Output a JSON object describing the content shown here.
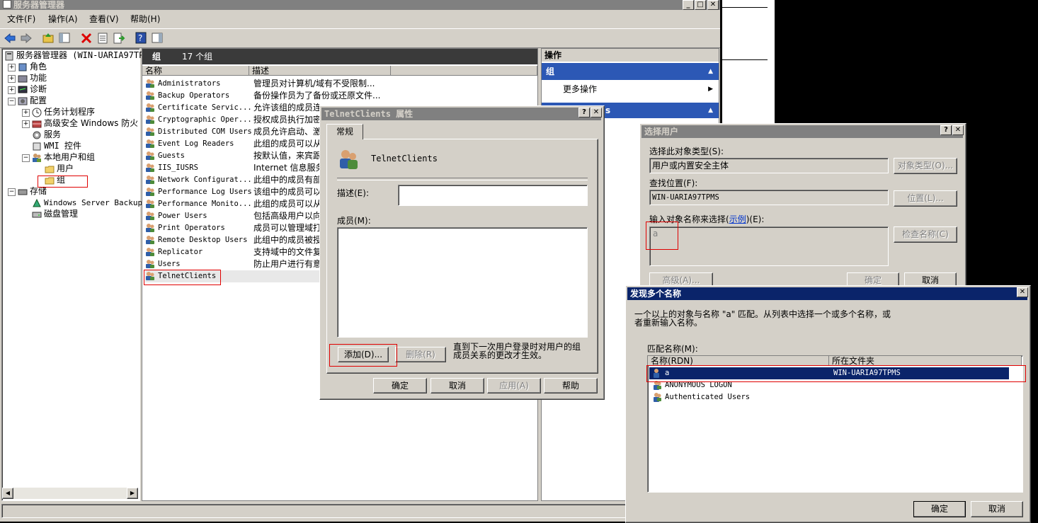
{
  "main_window": {
    "title": "服务器管理器",
    "menu": [
      "文件(F)",
      "操作(A)",
      "查看(V)",
      "帮助(H)"
    ],
    "caption_buttons": [
      "_",
      "□",
      "✕"
    ]
  },
  "tree": {
    "root": "服务器管理器 (WIN-UARIA97TPM",
    "items": [
      {
        "label": "角色"
      },
      {
        "label": "功能"
      },
      {
        "label": "诊断"
      },
      {
        "label": "配置"
      },
      {
        "label": "任务计划程序"
      },
      {
        "label": "高级安全 Windows 防火墙"
      },
      {
        "label": "服务"
      },
      {
        "label": "WMI 控件"
      },
      {
        "label": "本地用户和组"
      },
      {
        "label": "用户"
      },
      {
        "label": "组"
      },
      {
        "label": "存储"
      },
      {
        "label": "Windows Server Backup"
      },
      {
        "label": "磁盘管理"
      }
    ]
  },
  "groups_panel": {
    "header": "组",
    "count": "17 个组",
    "columns": [
      "名称",
      "描述"
    ],
    "rows": [
      {
        "name": "Administrators",
        "desc": "管理员对计算机/域有不受限制..."
      },
      {
        "name": "Backup Operators",
        "desc": "备份操作员为了备份或还原文件..."
      },
      {
        "name": "Certificate Servic...",
        "desc": "允许该组的成员连"
      },
      {
        "name": "Cryptographic Oper...",
        "desc": "授权成员执行加密"
      },
      {
        "name": "Distributed COM Users",
        "desc": "成员允许启动、激"
      },
      {
        "name": "Event Log Readers",
        "desc": "此组的成员可以从"
      },
      {
        "name": "Guests",
        "desc": "按默认值，来宾跟"
      },
      {
        "name": "IIS_IUSRS",
        "desc": "Internet 信息服务"
      },
      {
        "name": "Network Configurat...",
        "desc": "此组中的成员有部"
      },
      {
        "name": "Performance Log Users",
        "desc": "该组中的成员可以"
      },
      {
        "name": "Performance Monito...",
        "desc": "此组的成员可以从"
      },
      {
        "name": "Power Users",
        "desc": "包括高级用户以向"
      },
      {
        "name": "Print Operators",
        "desc": "成员可以管理域打"
      },
      {
        "name": "Remote Desktop Users",
        "desc": "此组中的成员被授"
      },
      {
        "name": "Replicator",
        "desc": "支持域中的文件复"
      },
      {
        "name": "Users",
        "desc": "防止用户进行有意"
      },
      {
        "name": "TelnetClients",
        "desc": ""
      }
    ]
  },
  "actions_panel": {
    "header": "操作",
    "section1": "组",
    "more": "更多操作",
    "section2": "s"
  },
  "props_dialog": {
    "title": "TelnetClients 属性",
    "tab": "常规",
    "group_name": "TelnetClients",
    "desc_label": "描述(E):",
    "members_label": "成员(M):",
    "add_btn": "添加(D)...",
    "remove_btn": "删除(R)",
    "note": "直到下一次用户登录时对用户的组成员关系的更改才生效。",
    "ok": "确定",
    "cancel": "取消",
    "apply": "应用(A)",
    "help": "帮助"
  },
  "select_users": {
    "title": "选择用户",
    "obj_type_label": "选择此对象类型(S):",
    "obj_type_value": "用户或内置安全主体",
    "obj_type_btn": "对象类型(O)...",
    "location_label": "查找位置(F):",
    "location_value": "WIN-UARIA97TPMS",
    "location_btn": "位置(L)...",
    "enter_label_pre": "输入对象名称来选择(",
    "enter_label_link": "示例",
    "enter_label_post": ")(E):",
    "entered": "a",
    "check_btn": "检查名称(C)",
    "advanced_btn": "高级(A)...",
    "ok": "确定",
    "cancel": "取消"
  },
  "multiple_names": {
    "title": "发现多个名称",
    "message_line1": "一个以上的对象与名称 \"a\" 匹配。从列表中选择一个或多个名称，或",
    "message_line2": "者重新输入名称。",
    "matches_label": "匹配名称(M):",
    "columns": [
      "名称(RDN)",
      "所在文件夹"
    ],
    "rows": [
      {
        "name": "a",
        "folder": "WIN-UARIA97TPMS"
      },
      {
        "name": "ANONYMOUS LOGON",
        "folder": ""
      },
      {
        "name": "Authenticated Users",
        "folder": ""
      }
    ],
    "ok": "确定",
    "cancel": "取消"
  },
  "colors": {
    "title_active": "#0a246a",
    "title_inactive": "#808080",
    "face": "#d4d0c8",
    "highlight_red": "#e00000",
    "actions_blue": "#2c58b5"
  }
}
